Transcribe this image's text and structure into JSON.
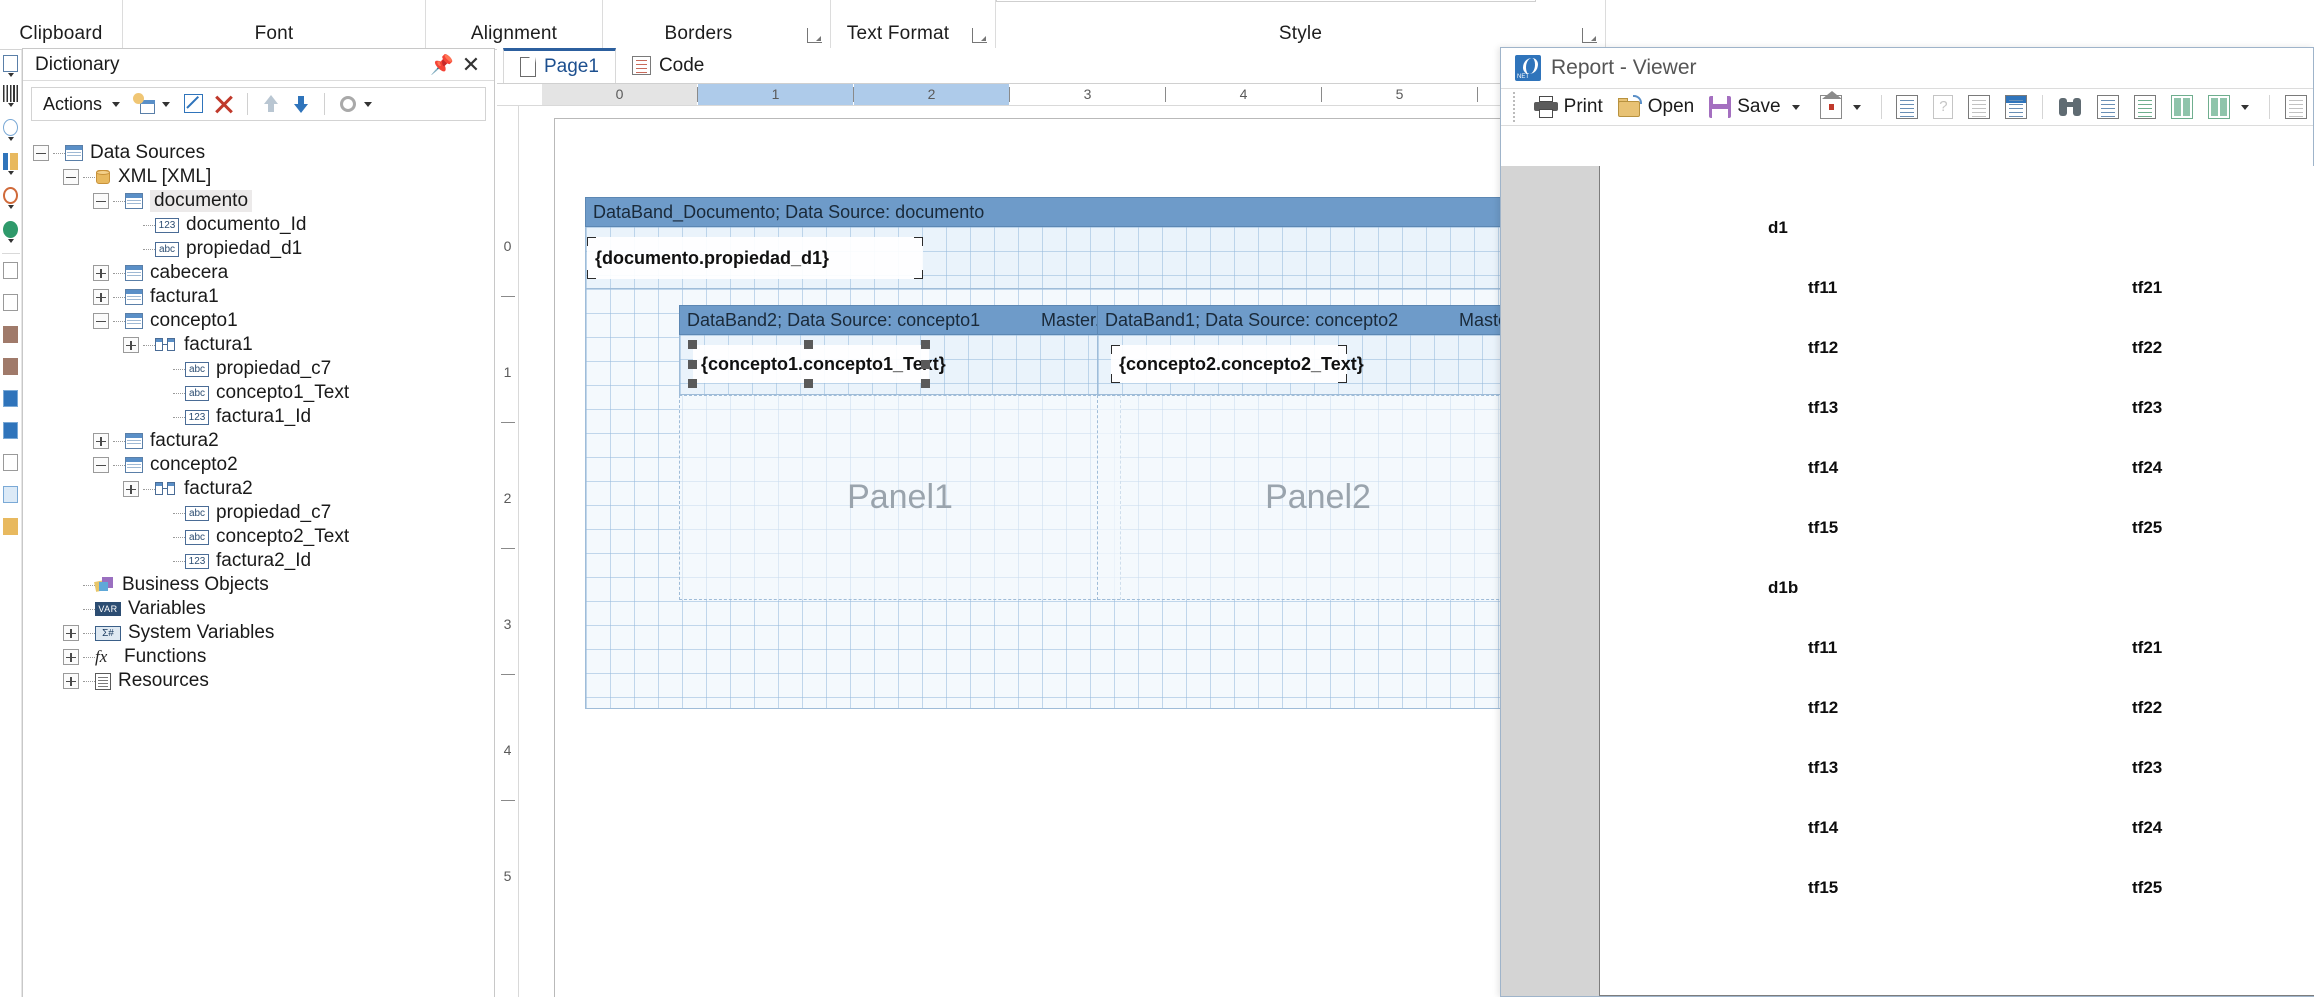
{
  "ribbon": {
    "groups": [
      {
        "label": "Clipboard",
        "launcher": false
      },
      {
        "label": "Font",
        "launcher": false
      },
      {
        "label": "Alignment",
        "launcher": false
      },
      {
        "label": "Borders",
        "launcher": true
      },
      {
        "label": "Text Format",
        "launcher": true
      },
      {
        "label": "Style",
        "launcher": true
      }
    ]
  },
  "dictionary": {
    "title": "Dictionary",
    "pin_icon": "pin-icon",
    "close_icon": "close-icon",
    "toolbar": {
      "actions_label": "Actions",
      "new_item_icon": "new-item-icon",
      "edit_icon": "edit-icon",
      "delete_icon": "delete-icon",
      "move_up_icon": "move-up-icon",
      "move_down_icon": "move-down-icon",
      "settings_icon": "gear-icon"
    },
    "tree": [
      {
        "label": "Data Sources",
        "depth": 0,
        "state": "minus",
        "icon": "table-icon",
        "selected": false
      },
      {
        "label": "XML [XML]",
        "depth": 1,
        "state": "minus",
        "icon": "database-icon",
        "selected": false
      },
      {
        "label": "documento",
        "depth": 2,
        "state": "minus",
        "icon": "table-icon",
        "selected": true
      },
      {
        "label": "documento_Id",
        "depth": 3,
        "state": "leaf",
        "icon": "number-field-icon",
        "selected": false
      },
      {
        "label": "propiedad_d1",
        "depth": 3,
        "state": "leaf",
        "icon": "text-field-icon",
        "selected": false
      },
      {
        "label": "cabecera",
        "depth": 2,
        "state": "plus",
        "icon": "table-icon",
        "selected": false
      },
      {
        "label": "factura1",
        "depth": 2,
        "state": "plus",
        "icon": "table-icon",
        "selected": false
      },
      {
        "label": "concepto1",
        "depth": 2,
        "state": "minus",
        "icon": "table-icon",
        "selected": false
      },
      {
        "label": "factura1",
        "depth": 3,
        "state": "plus",
        "icon": "relation-icon",
        "selected": false
      },
      {
        "label": "propiedad_c7",
        "depth": 4,
        "state": "leaf",
        "icon": "text-field-icon",
        "selected": false
      },
      {
        "label": "concepto1_Text",
        "depth": 4,
        "state": "leaf",
        "icon": "text-field-icon",
        "selected": false
      },
      {
        "label": "factura1_Id",
        "depth": 4,
        "state": "leaf",
        "icon": "number-field-icon",
        "selected": false
      },
      {
        "label": "factura2",
        "depth": 2,
        "state": "plus",
        "icon": "table-icon",
        "selected": false
      },
      {
        "label": "concepto2",
        "depth": 2,
        "state": "minus",
        "icon": "table-icon",
        "selected": false
      },
      {
        "label": "factura2",
        "depth": 3,
        "state": "plus",
        "icon": "relation-icon",
        "selected": false
      },
      {
        "label": "propiedad_c7",
        "depth": 4,
        "state": "leaf",
        "icon": "text-field-icon",
        "selected": false
      },
      {
        "label": "concepto2_Text",
        "depth": 4,
        "state": "leaf",
        "icon": "text-field-icon",
        "selected": false
      },
      {
        "label": "factura2_Id",
        "depth": 4,
        "state": "leaf",
        "icon": "number-field-icon",
        "selected": false
      },
      {
        "label": "Business Objects",
        "depth": 1,
        "state": "leaf",
        "icon": "business-objects-icon",
        "selected": false
      },
      {
        "label": "Variables",
        "depth": 1,
        "state": "leaf",
        "icon": "variables-icon",
        "selected": false
      },
      {
        "label": "System Variables",
        "depth": 1,
        "state": "plus",
        "icon": "system-variables-icon",
        "selected": false
      },
      {
        "label": "Functions",
        "depth": 1,
        "state": "plus",
        "icon": "functions-icon",
        "selected": false
      },
      {
        "label": "Resources",
        "depth": 1,
        "state": "plus",
        "icon": "resources-icon",
        "selected": false
      }
    ]
  },
  "designer": {
    "tabs": [
      {
        "label": "Page1",
        "icon": "page-icon",
        "active": true
      },
      {
        "label": "Code",
        "icon": "code-icon",
        "active": false
      }
    ],
    "ruler_h": [
      "0",
      "1",
      "2",
      "3",
      "4",
      "5"
    ],
    "ruler_v": [
      "0",
      "1",
      "2",
      "3",
      "4",
      "5"
    ],
    "bands": [
      {
        "header": "DataBand_Documento; Data Source: documento",
        "header_right": "",
        "text": "{documento.propiedad_d1}"
      },
      {
        "header": "DataBand2; Data Source: concepto1",
        "header_right": "Master...",
        "text": "{concepto1.concepto1_Text}",
        "panel": "Panel1"
      },
      {
        "header": "DataBand1; Data Source: concepto2",
        "header_right": "Master...",
        "text": "{concepto2.concepto2_Text}",
        "panel": "Panel2"
      }
    ]
  },
  "viewer": {
    "title": "Report - Viewer",
    "app_icon": "stimulsoft-icon",
    "toolbar": [
      {
        "name": "print-button",
        "label": "Print",
        "icon": "printer-icon",
        "caret": false
      },
      {
        "name": "open-button",
        "label": "Open",
        "icon": "open-folder-icon",
        "caret": false
      },
      {
        "name": "save-button",
        "label": "Save",
        "icon": "save-icon",
        "caret": true
      },
      {
        "name": "send-email-button",
        "label": "",
        "icon": "send-mail-icon",
        "caret": true
      },
      {
        "name": "page-setup-button",
        "label": "",
        "icon": "page-setup-icon",
        "caret": false
      },
      {
        "name": "help-button",
        "label": "",
        "icon": "question-icon",
        "caret": false
      },
      {
        "name": "new-page-button",
        "label": "",
        "icon": "blank-page-icon",
        "caret": false
      },
      {
        "name": "bookmarks-button",
        "label": "",
        "icon": "bookmarks-icon",
        "caret": false
      },
      {
        "name": "find-button",
        "label": "",
        "icon": "binoculars-icon",
        "caret": false
      },
      {
        "name": "page-view-button",
        "label": "",
        "icon": "single-page-icon",
        "caret": false
      },
      {
        "name": "continuous-button",
        "label": "",
        "icon": "continuous-page-icon",
        "caret": false
      },
      {
        "name": "two-page-button",
        "label": "",
        "icon": "two-columns-icon",
        "caret": false
      },
      {
        "name": "multi-page-button",
        "label": "",
        "icon": "multi-page-icon",
        "caret": true
      },
      {
        "name": "zoom-button",
        "label": "",
        "icon": "zoom-page-icon",
        "caret": false
      }
    ],
    "report": {
      "groups": [
        {
          "title": "d1",
          "rows": [
            {
              "left": "tf11",
              "right": "tf21"
            },
            {
              "left": "tf12",
              "right": "tf22"
            },
            {
              "left": "tf13",
              "right": "tf23"
            },
            {
              "left": "tf14",
              "right": "tf24"
            },
            {
              "left": "tf15",
              "right": "tf25"
            }
          ]
        },
        {
          "title": "d1b",
          "rows": [
            {
              "left": "tf11",
              "right": "tf21"
            },
            {
              "left": "tf12",
              "right": "tf22"
            },
            {
              "left": "tf13",
              "right": "tf23"
            },
            {
              "left": "tf14",
              "right": "tf24"
            },
            {
              "left": "tf15",
              "right": "tf25"
            }
          ]
        }
      ]
    }
  },
  "colors": {
    "band_header": "#6e9bc9",
    "band_body": "#eaf3fb",
    "accent": "#2c5f9e",
    "ruler_selected": "#aecbea"
  }
}
